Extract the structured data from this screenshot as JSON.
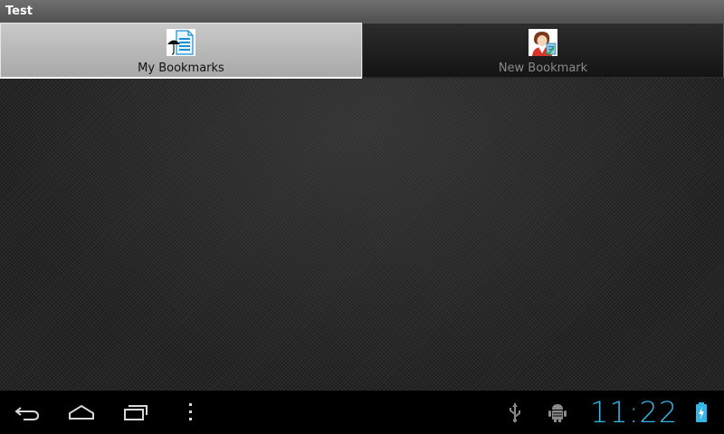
{
  "app": {
    "title": "Test"
  },
  "tabs": [
    {
      "label": "My Bookmarks",
      "icon": "bookmark-document-icon",
      "selected": true
    },
    {
      "label": "New Bookmark",
      "icon": "person-bookmark-icon",
      "selected": false
    }
  ],
  "navbar": {
    "buttons": [
      "back-icon",
      "home-icon",
      "recent-apps-icon",
      "menu-icon"
    ]
  },
  "status": {
    "icons": [
      "usb-icon",
      "android-debug-icon",
      "battery-charging-icon"
    ],
    "time": "11:22",
    "accent_color": "#33b5e5"
  }
}
